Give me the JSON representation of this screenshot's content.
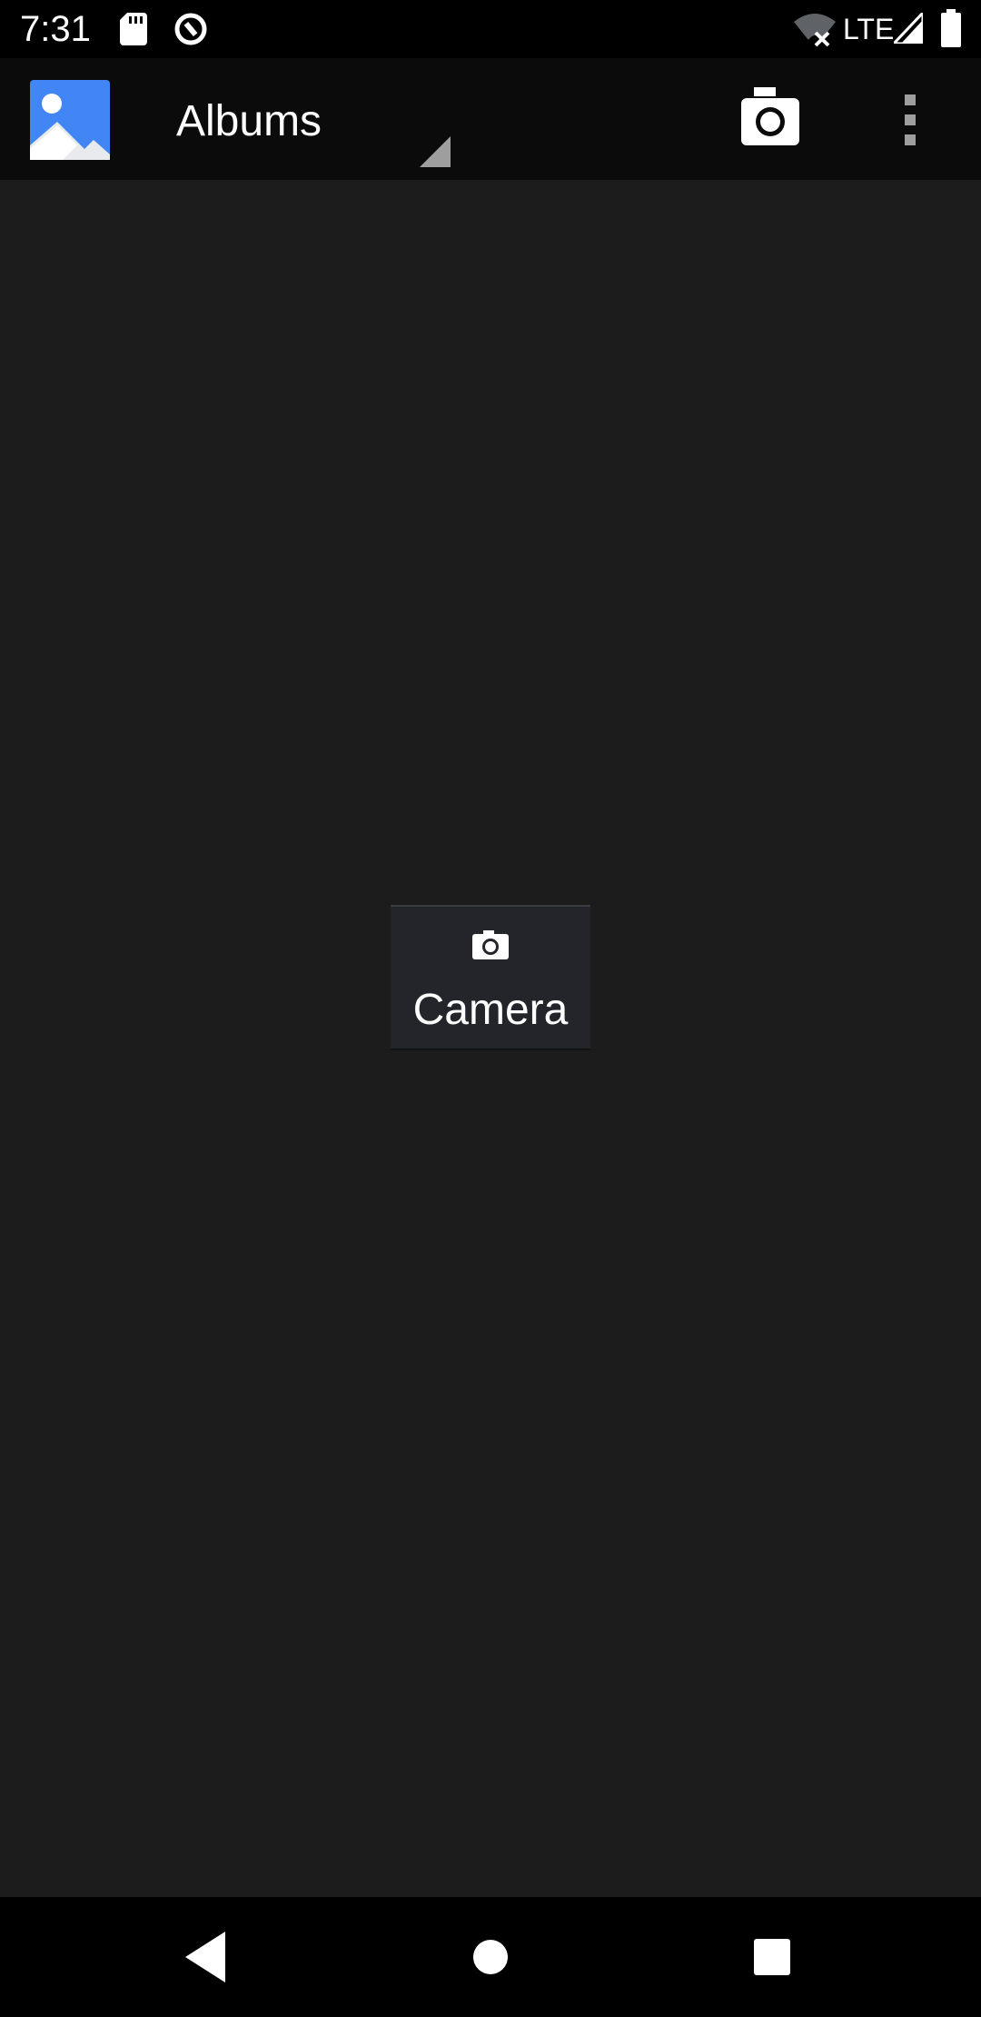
{
  "status_bar": {
    "time": "7:31",
    "network": "LTE",
    "icons": [
      "sd-card-icon",
      "data-saver-icon",
      "wifi-off-icon",
      "signal-icon",
      "battery-icon"
    ]
  },
  "app_bar": {
    "logo_icon": "gallery-logo-icon",
    "spinner_label": "Albums",
    "actions": [
      "camera-icon",
      "overflow-menu-icon"
    ]
  },
  "albums": [
    {
      "label": "Camera",
      "icon": "camera-icon"
    }
  ],
  "nav_bar": {
    "buttons": [
      "back-icon",
      "home-icon",
      "recents-icon"
    ]
  },
  "colors": {
    "background": "#1c1c1c",
    "app_bar": "#0b0b0b",
    "status_bar": "#000000",
    "tile": "#23252a",
    "logo_blue": "#4285f4"
  }
}
